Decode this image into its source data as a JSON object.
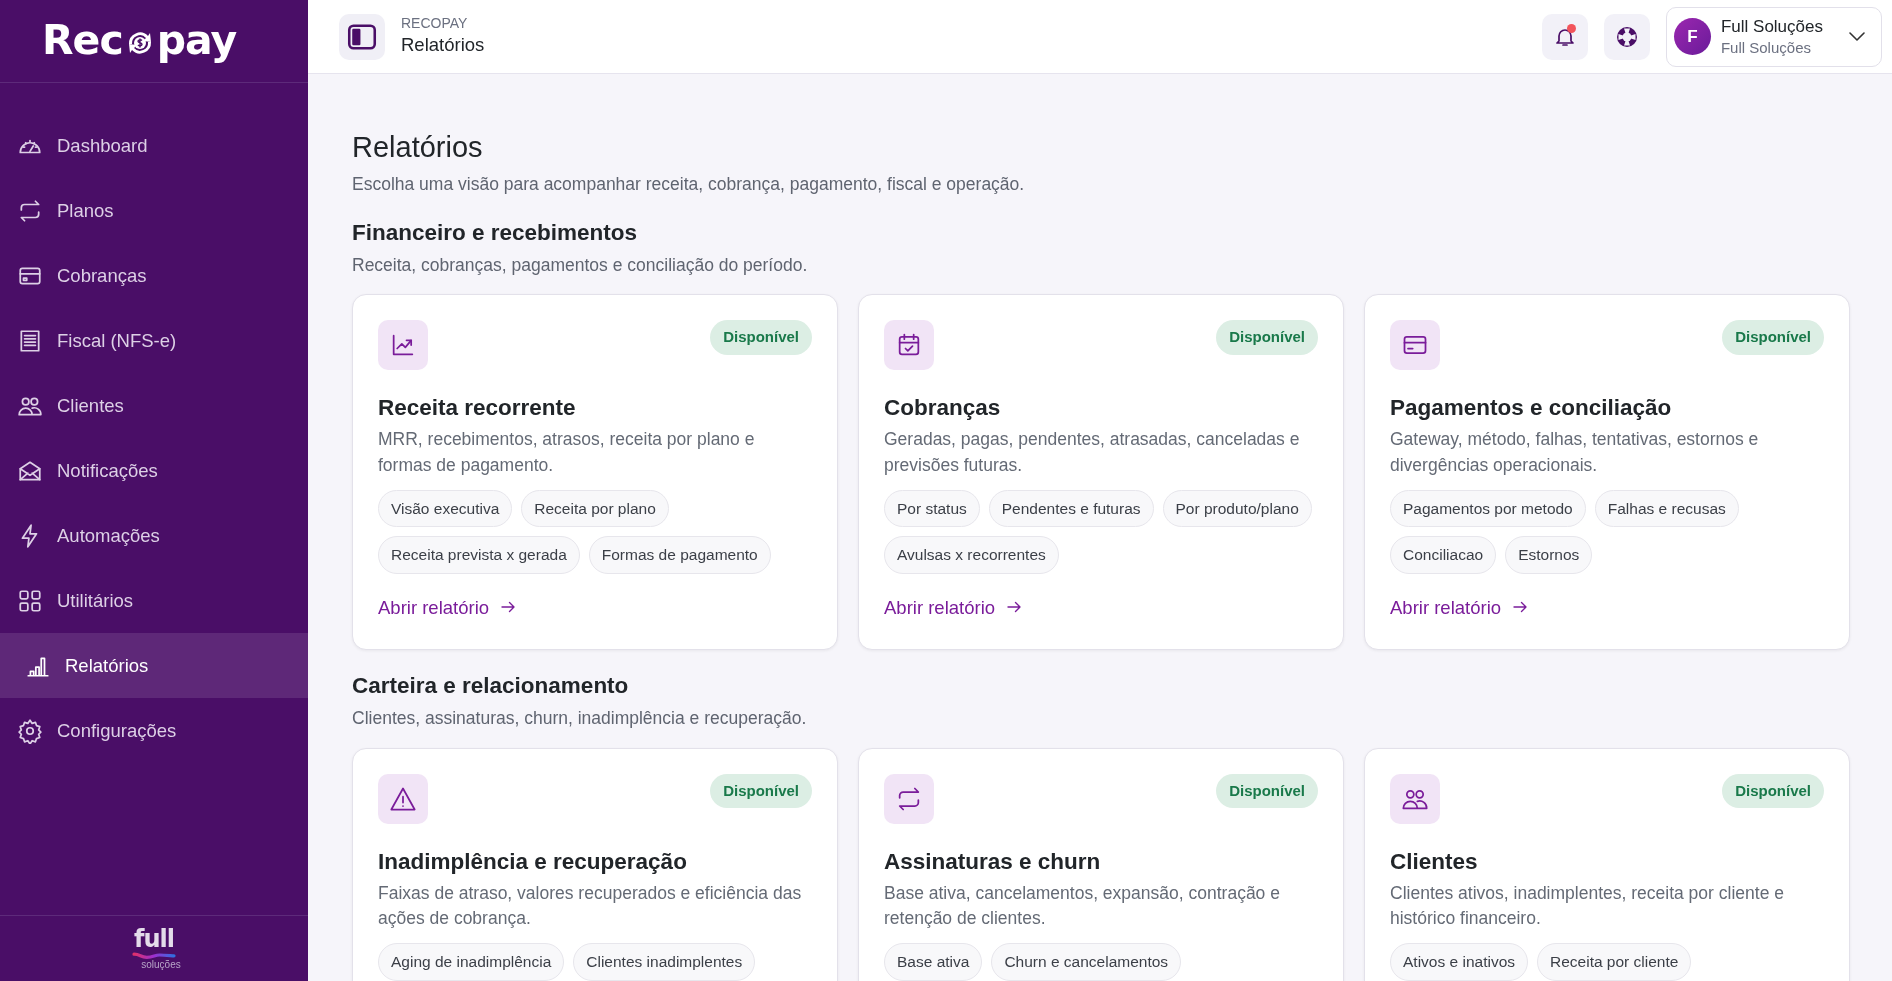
{
  "sidebar": {
    "logo": {
      "before": "Rec",
      "after": "pay"
    },
    "items": [
      {
        "label": "Dashboard",
        "selected": false
      },
      {
        "label": "Planos",
        "selected": false
      },
      {
        "label": "Cobranças",
        "selected": false
      },
      {
        "label": "Fiscal (NFS-e)",
        "selected": false
      },
      {
        "label": "Clientes",
        "selected": false
      },
      {
        "label": "Notificações",
        "selected": false
      },
      {
        "label": "Automações",
        "selected": false
      },
      {
        "label": "Utilitários",
        "selected": false
      },
      {
        "label": "Relatórios",
        "selected": true
      },
      {
        "label": "Configurações",
        "selected": false
      }
    ],
    "footer_logo": {
      "word": "full",
      "tagline": "soluções"
    }
  },
  "header": {
    "app": "RECOPAY",
    "page": "Relatórios",
    "notifications_unread": true,
    "user": {
      "initial": "F",
      "name": "Full Soluções",
      "company": "Full Soluções"
    }
  },
  "page": {
    "title": "Relatórios",
    "subtitle": "Escolha uma visão para acompanhar receita, cobrança, pagamento, fiscal e operação."
  },
  "sections": [
    {
      "title": "Financeiro e recebimentos",
      "subtitle": "Receita, cobranças, pagamentos e conciliação do período.",
      "cards": [
        {
          "status": "Disponível",
          "title": "Receita recorrente",
          "description": "MRR, recebimentos, atrasos, receita por plano e formas de pagamento.",
          "tags": [
            "Visão executiva",
            "Receita por plano",
            "Receita prevista x gerada",
            "Formas de pagamento"
          ],
          "link": "Abrir relatório"
        },
        {
          "status": "Disponível",
          "title": "Cobranças",
          "description": "Geradas, pagas, pendentes, atrasadas, canceladas e previsões futuras.",
          "tags": [
            "Por status",
            "Pendentes e futuras",
            "Por produto/plano",
            "Avulsas x recorrentes"
          ],
          "link": "Abrir relatório"
        },
        {
          "status": "Disponível",
          "title": "Pagamentos e conciliação",
          "description": "Gateway, método, falhas, tentativas, estornos e divergências operacionais.",
          "tags": [
            "Pagamentos por metodo",
            "Falhas e recusas",
            "Conciliacao",
            "Estornos"
          ],
          "link": "Abrir relatório"
        }
      ]
    },
    {
      "title": "Carteira e relacionamento",
      "subtitle": "Clientes, assinaturas, churn, inadimplência e recuperação.",
      "cards": [
        {
          "status": "Disponível",
          "title": "Inadimplência e recuperação",
          "description": "Faixas de atraso, valores recuperados e eficiência das ações de cobrança.",
          "tags": [
            "Aging de inadimplência",
            "Clientes inadimplentes"
          ]
        },
        {
          "status": "Disponível",
          "title": "Assinaturas e churn",
          "description": "Base ativa, cancelamentos, expansão, contração e retenção de clientes.",
          "tags": [
            "Base ativa",
            "Churn e cancelamentos"
          ]
        },
        {
          "status": "Disponível",
          "title": "Clientes",
          "description": "Clientes ativos, inadimplentes, receita por cliente e histórico financeiro.",
          "tags": [
            "Ativos e inativos",
            "Receita por cliente"
          ]
        }
      ]
    }
  ]
}
